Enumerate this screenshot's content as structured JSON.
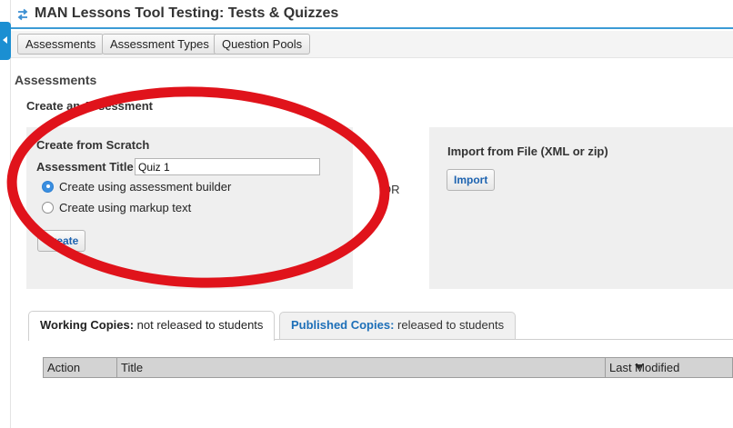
{
  "header": {
    "title": "MAN Lessons Tool Testing: Tests & Quizzes",
    "title_icon": "swap-arrows-icon"
  },
  "toolbar": {
    "buttons": [
      "Assessments",
      "Assessment Types",
      "Question Pools"
    ]
  },
  "main": {
    "section_heading": "Assessments",
    "sub_heading": "Create an Assessment",
    "create_panel": {
      "title": "Create from Scratch",
      "title_label": "Assessment Title",
      "title_value": "Quiz 1",
      "options": [
        {
          "label": "Create using assessment builder",
          "checked": true
        },
        {
          "label": "Create using markup text",
          "checked": false
        }
      ],
      "create_button": "Create"
    },
    "or_text": "OR",
    "import_panel": {
      "title": "Import from File (XML or zip)",
      "import_button": "Import"
    }
  },
  "tabs": [
    {
      "strong": "Working Copies:",
      "rest": " not released to students",
      "active": true
    },
    {
      "strong": "Published Copies:",
      "rest": " released to students",
      "active": false
    }
  ],
  "table": {
    "columns": [
      "Action",
      "Title",
      "Last Modified"
    ]
  },
  "colors": {
    "accent": "#3b9bd5",
    "annotation_red": "#e0131b",
    "link_blue": "#1d63b0"
  }
}
